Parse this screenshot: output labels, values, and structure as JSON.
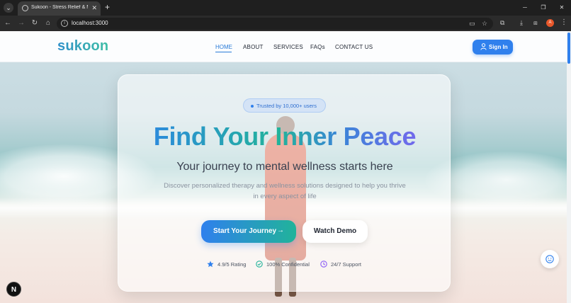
{
  "browser": {
    "tab_title": "Sukoon - Stress Relief & Mental",
    "url": "localhost:3000",
    "profile_initial": "A"
  },
  "site": {
    "logo": "sukoon",
    "nav": [
      "HOME",
      "ABOUT",
      "SERVICES",
      "FAQs",
      "CONTACT US"
    ],
    "signin_label": "Sign In"
  },
  "hero": {
    "badge": "Trusted by 10,000+ users",
    "headline": "Find Your Inner Peace",
    "subheadline": "Your journey to mental wellness starts here",
    "description": "Discover personalized therapy and wellness solutions designed to help you thrive in every aspect of life",
    "primary_button": "Start Your Journey",
    "secondary_button": "Watch Demo",
    "stats": [
      "4.9/5 Rating",
      "100% Confidential",
      "24/7 Support"
    ]
  },
  "colors": {
    "accent_blue": "#2f80ed",
    "accent_green": "#22b39a",
    "accent_purple": "#8b5cf6"
  },
  "next_badge": "N"
}
